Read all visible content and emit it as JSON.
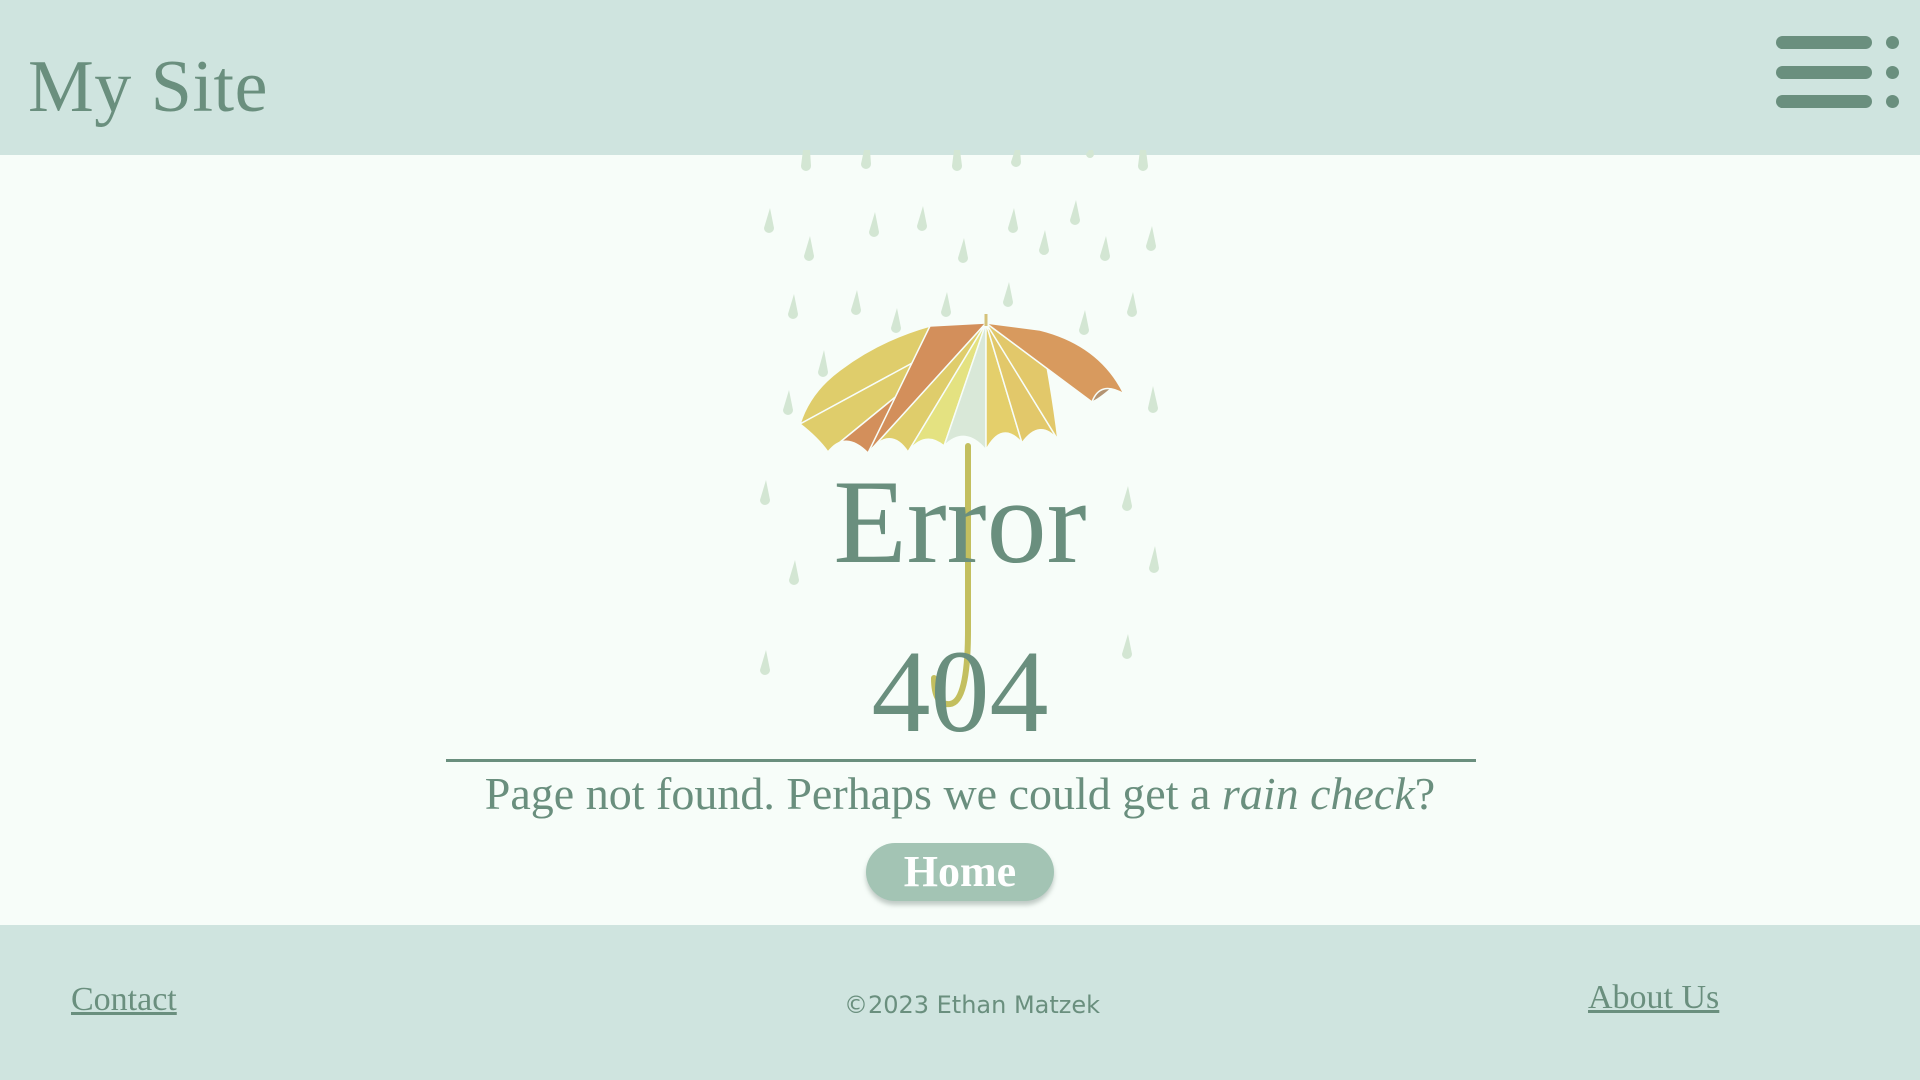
{
  "header": {
    "site_title": "My Site",
    "menu_icon": "hamburger-menu-icon"
  },
  "main": {
    "illustration_icon": "umbrella-in-rain-icon",
    "error_word": "Error",
    "error_code": "404",
    "message_prefix": "Page not found. Perhaps we could get a ",
    "message_emphasis": "rain check",
    "message_suffix": "?",
    "home_button_label": "Home"
  },
  "footer": {
    "contact_label": "Contact",
    "copyright": "©2023 Ethan Matzek",
    "about_label": "About Us"
  },
  "colors": {
    "header_bg": "#cfe4df",
    "page_bg": "#f7fdf9",
    "text": "#6a8f7e",
    "button_bg": "#a3c4b4",
    "raindrop": "#d3e6d3",
    "umbrella_handle": "#c3bf5f"
  }
}
